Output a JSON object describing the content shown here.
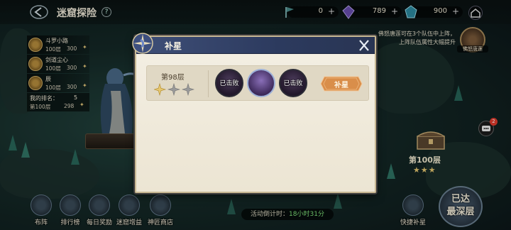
{
  "header": {
    "title": "迷窟探险",
    "help_label": "?",
    "resources": [
      {
        "icon": "flag-icon",
        "value": "0",
        "plus": "+"
      },
      {
        "icon": "purple-crystal-icon",
        "value": "789",
        "plus": "+"
      },
      {
        "icon": "blue-gem-icon",
        "value": "900",
        "plus": "+"
      }
    ]
  },
  "ranking": {
    "items": [
      {
        "name": "斗罗小路",
        "floor": "100层",
        "points": "300"
      },
      {
        "name": "剑道尘心",
        "floor": "100层",
        "points": "300"
      },
      {
        "name": "辰",
        "floor": "100层",
        "points": "300"
      }
    ],
    "my_rank_label": "我的排名：",
    "my_rank_value": "5",
    "my_floor": "第100层",
    "my_points": "298"
  },
  "side": {
    "hint": "佛怒唐莲可在3个队伍中上阵，上阵队伍属性大幅提升",
    "master_label": "佛怒唐莲",
    "chat_badge": "2",
    "floor_label": "第100层",
    "floor_stars": "★★★"
  },
  "bottom": {
    "formation": "布阵",
    "leaderboard": "排行榜",
    "daily": "每日奖励",
    "boost": "迷窟增益",
    "shop": "神匠商店",
    "countdown_label": "活动倒计时：",
    "countdown_time": "18小时31分",
    "quickstar": "快捷补星",
    "deepest_line1": "已达",
    "deepest_line2": "最深层"
  },
  "modal": {
    "title": "补星",
    "row": {
      "floor_label": "第98层",
      "stars_earned": 1,
      "stars_total": 3,
      "enemies": [
        {
          "status": "已击败",
          "defeated": true
        },
        {
          "status": "",
          "defeated": false
        },
        {
          "status": "已击败",
          "defeated": true
        }
      ],
      "button_label": "补星"
    }
  },
  "colors": {
    "modal_header": "#3f4f78",
    "button_orange": "#d98e4a",
    "star_gold": "#e5c66f",
    "countdown_green": "#7fe07a"
  }
}
